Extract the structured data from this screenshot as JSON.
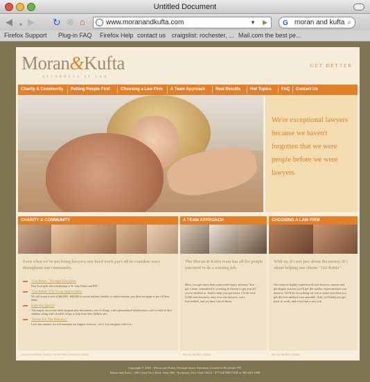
{
  "window": {
    "title": "Untitled Document"
  },
  "toolbar": {
    "back_icon": "back-arrow-icon",
    "forward_icon": "forward-arrow-icon",
    "reload_icon": "reload-icon",
    "stop_icon": "stop-icon",
    "home_icon": "home-icon",
    "url": "www.moranandkufta.com",
    "search_text": "moran and kufta"
  },
  "bookmarks": [
    "Firefox Support",
    "Plug-in FAQ",
    "Firefox Help",
    "contact us",
    "craigslist: rochester, ...",
    "Mail.com the best pe..."
  ],
  "site": {
    "logo_part1": "Moran",
    "logo_amp": "&",
    "logo_part2": "Kufta",
    "tagline": "ATTORNEYS AT LAW",
    "get_better": "GET BETTER",
    "nav": [
      "Charity & Community",
      "Putting People First",
      "Choosing a Law Firm",
      "A Team Approach",
      "Real Results",
      "Hot Topics",
      "FAQ",
      "Contact Us"
    ],
    "hero_quote": "We're exceptional lawyers because we haven't forgotten that we were people before we were lawyers."
  },
  "columns": {
    "charity": {
      "heading": "CHARITY & COMMUNITY",
      "lede": "Even when we're not being lawyers, our hard work pays off in countless ways throughout our community.",
      "items": [
        {
          "title": "\"Get Better\" Through Education",
          "text": "Four local girls win scholarships to St. John Fisher and RIT."
        },
        {
          "title": "\"Get Better\" UN Troop Appreciation",
          "text": "We will award a total of $40,000 - $80,000 to several military families to replace income, pay their mortgage or pay off their debts."
        },
        {
          "title": "Kids Are Special",
          "text": "This hugely successful safety program provides parents, free of charge, with a personalized identification card for each of their children, along with a booklet of tips to help keep their children safe."
        },
        {
          "title": "\"Home For The Holidays\"",
          "text": "Later this summer, we will announce our biggest event yet - see if you can guess what it is."
        }
      ],
      "learn_more": "LEARN MORE ABOUT OUR PROGRAMS HERE"
    },
    "team": {
      "heading": "A TEAM APPROACH",
      "lede": "The Moran & Kufta team has all the people you need to do a winning job.",
      "text": "Here, you get more than a personal injury attorney. You get a team committed to working tirelessly to get you all you're entitled to. And to help you get better. Of the over 2,000 area lawsuits, only four our lawyers, were lost/settled, and we have lots of them.",
      "learn_more": "READ MORE HERE"
    },
    "choosing": {
      "heading": "CHOOSING A LAW FIRM",
      "lede": "With us, it's not just about the money. It's about helping our clients \"Get Better\".",
      "text": "Our team of highly experienced trial lawyers, nurses and paralegals ensures you'll get the quality representation you deserve. We'll do everything we can to make sure that you get the best medical care possible. And, we'll help you get back to work, and even find a new job.",
      "learn_more": "READ MORE HERE"
    }
  },
  "footer": {
    "line1": "Copyright © 2005 - Moran and Kufta, Personal Injury Attorneys Located in Rochester NY.",
    "line2": "Moran and Kufta · 200 Canal View Blvd. Suite 206 · Rochester, New York 14623 · 877-GETBETTER or 585-442-1000"
  }
}
